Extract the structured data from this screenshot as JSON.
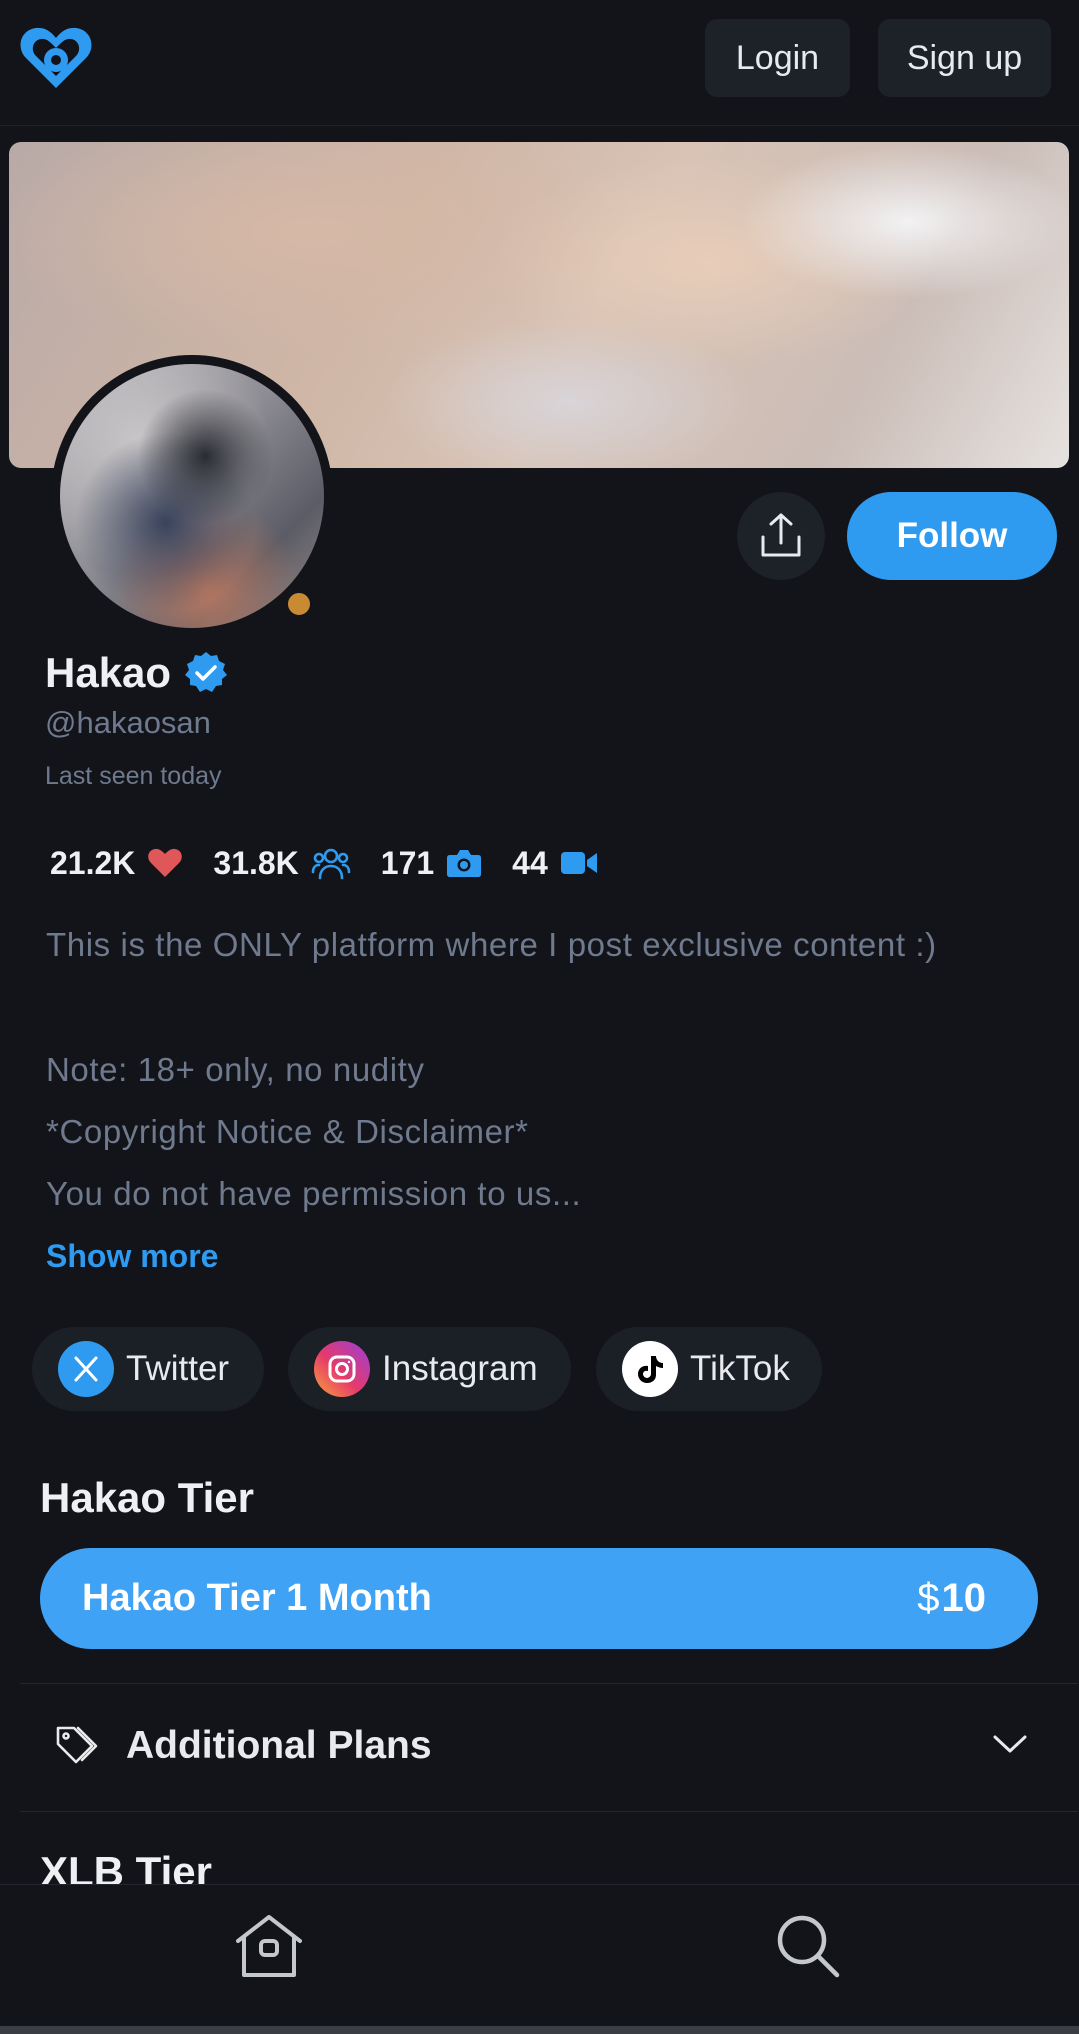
{
  "header": {
    "login_label": "Login",
    "signup_label": "Sign up"
  },
  "profile": {
    "name": "Hakao",
    "handle": "@hakaosan",
    "last_seen": "Last seen today",
    "follow_label": "Follow",
    "online_status_color": "#c98a34",
    "verified_color": "#2f9bf0"
  },
  "stats": {
    "likes": "21.2K",
    "subscribers": "31.8K",
    "photos": "171",
    "videos": "44"
  },
  "bio": {
    "line1": "This is the ONLY platform where I post exclusive content :)",
    "line2": "Note: 18+ only, no nudity",
    "line3": "*Copyright Notice & Disclaimer*",
    "line4": "You do not have permission to us...",
    "show_more": "Show more"
  },
  "socials": [
    {
      "label": "Twitter",
      "icon": "x-icon"
    },
    {
      "label": "Instagram",
      "icon": "instagram-icon"
    },
    {
      "label": "TikTok",
      "icon": "tiktok-icon"
    }
  ],
  "tier": {
    "title": "Hakao Tier",
    "plan_name": "Hakao Tier 1 Month",
    "currency": "$",
    "price": "10"
  },
  "additional_plans": {
    "label": "Additional Plans"
  },
  "next_tier_title": "XLB Tier",
  "colors": {
    "accent": "#2f9bf0",
    "background": "#121419",
    "muted_text": "#6f7a8e"
  }
}
